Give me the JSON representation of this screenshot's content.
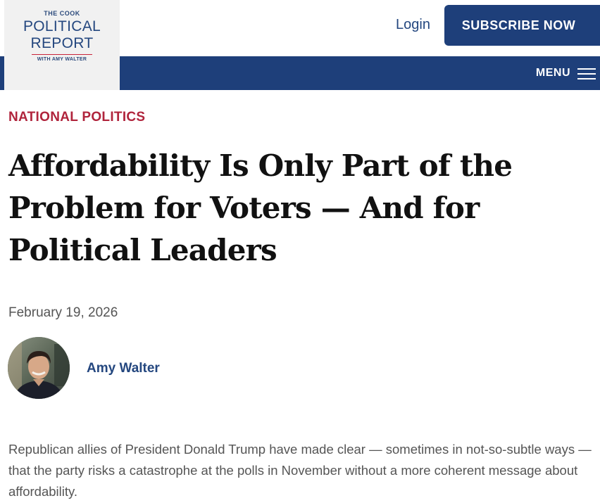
{
  "header": {
    "logo": {
      "line1": "THE COOK",
      "line2": "POLITICAL",
      "line3": "REPORT",
      "line4": "WITH AMY WALTER"
    },
    "login_label": "Login",
    "subscribe_label": "SUBSCRIBE NOW",
    "menu_label": "MENU",
    "menu_icon": "hamburger-menu-icon"
  },
  "article": {
    "category": "NATIONAL POLITICS",
    "headline": "Affordability Is Only Part of the Problem for Voters — And for Political Leaders",
    "date": "February 19, 2026",
    "author": {
      "name": "Amy Walter"
    },
    "lede": "Republican allies of President Donald Trump have made clear — sometimes in not-so-subtle ways — that the party risks a catastrophe at the polls in November without a more coherent message about affordability."
  },
  "colors": {
    "brand_navy": "#1e3f7a",
    "category_red": "#b0243c",
    "link_blue": "#24477f",
    "logo_background": "#f1f1f1"
  }
}
